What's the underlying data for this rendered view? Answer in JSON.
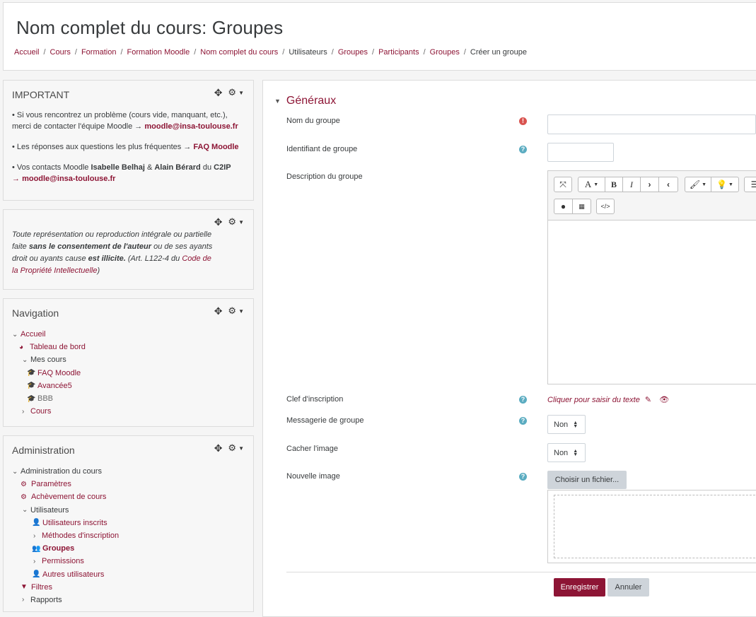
{
  "header": {
    "title": "Nom complet du cours: Groupes",
    "breadcrumb": [
      "Accueil",
      "Cours",
      "Formation",
      "Formation Moodle",
      "Nom complet du cours",
      "Utilisateurs",
      "Groupes",
      "Participants",
      "Groupes",
      "Créer un groupe"
    ],
    "separator": "/"
  },
  "blocks": {
    "important": {
      "title": "IMPORTANT",
      "line1_text": "• Si vous rencontrez un problème (cours vide, manquant, etc.), merci de contacter l'équipe Moodle → ",
      "line1_link": "moodle@insa-toulouse.fr",
      "line2_text": "• Les réponses aux questions les plus fréquentes → ",
      "line2_link": "FAQ Moodle",
      "line3_prefix": "• Vos contacts Moodle ",
      "line3_name1": "Isabelle Belhaj",
      "line3_amp": " & ",
      "line3_name2": "Alain Bérard",
      "line3_mid": " du ",
      "line3_unit": "C2IP",
      "line3_arrow": "→ ",
      "line3_link": "moodle@insa-toulouse.fr"
    },
    "copyright": {
      "part1": "Toute représentation ou reproduction intégrale ou partielle faite ",
      "bold1": "sans le consentement de l'auteur",
      "part2": " ou de ses ayants droit ou ayants cause ",
      "bold2": "est illicite.",
      "part3": " (Art. L122-4 du ",
      "link": "Code de la Propriété Intellectuelle",
      "part4": ")"
    },
    "navigation": {
      "title": "Navigation",
      "items": [
        "Accueil",
        "Tableau de bord",
        "Mes cours",
        "FAQ Moodle",
        "Avancée5",
        "BBB",
        "Cours"
      ]
    },
    "administration": {
      "title": "Administration",
      "items": [
        "Administration du cours",
        "Paramètres",
        "Achèvement de cours",
        "Utilisateurs",
        "Utilisateurs inscrits",
        "Méthodes d'inscription",
        "Groupes",
        "Permissions",
        "Autres utilisateurs",
        "Filtres",
        "Rapports"
      ]
    }
  },
  "form": {
    "section_title": "Généraux",
    "fields": {
      "name_label": "Nom du groupe",
      "name_value": "",
      "idnumber_label": "Identifiant de groupe",
      "idnumber_value": "",
      "description_label": "Description du groupe",
      "enrolkey_label": "Clef d'inscription",
      "enrolkey_placeholder": "Cliquer pour saisir du texte",
      "messaging_label": "Messagerie de groupe",
      "messaging_value": "Non",
      "hidepicture_label": "Cacher l'image",
      "hidepicture_value": "Non",
      "newpicture_label": "Nouvelle image",
      "filepicker_label": "Choisir un fichier..."
    },
    "editor_toolbar": {
      "font_label": "A",
      "bold_label": "B",
      "italic_label": "I"
    },
    "buttons": {
      "save": "Enregistrer",
      "cancel": "Annuler"
    }
  },
  "colors": {
    "brand": "#8d1535",
    "help_icon": "#5bacc1",
    "required_icon": "#d9534f"
  }
}
